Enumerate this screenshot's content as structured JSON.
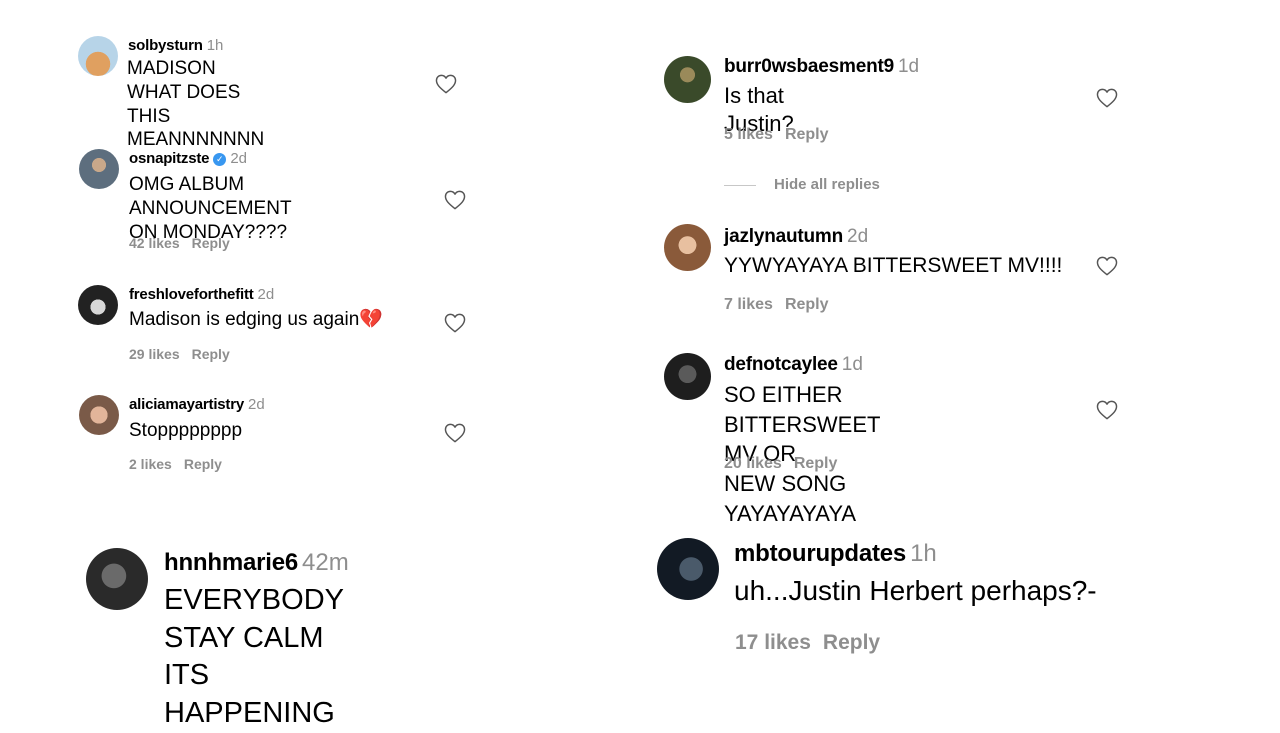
{
  "comments": [
    {
      "user": "solbysturn",
      "time": "1h",
      "text": "MADISON WHAT DOES THIS\nMEANNNNNNN",
      "likes": "",
      "reply": "",
      "avatar_color": "#d9b98a"
    },
    {
      "user": "osnapitzste",
      "time": "2d",
      "text": "OMG ALBUM ANNOUNCEMENT\nON MONDAY????",
      "likes": "42 likes",
      "reply": "Reply",
      "avatar_color": "#6b7a8a",
      "verified": true
    },
    {
      "user": "freshloveforthefitt",
      "time": "2d",
      "text": "Madison is edging us again",
      "emoji": "💔",
      "likes": "29 likes",
      "reply": "Reply",
      "avatar_color": "#2b2b2b"
    },
    {
      "user": "aliciamayartistry",
      "time": "2d",
      "text": "Stopppppppp",
      "likes": "2 likes",
      "reply": "Reply",
      "avatar_color": "#b88a6a"
    },
    {
      "user": "hnnhmarie6",
      "time": "42m",
      "text": "EVERYBODY STAY CALM ITS\nHAPPENING",
      "likes": "",
      "reply": "",
      "avatar_color": "#3a3a3a"
    },
    {
      "user": "burr0wsbaesment9",
      "time": "1d",
      "text": "Is that Justin?",
      "likes": "5 likes",
      "reply": "Reply",
      "avatar_color": "#4a5a3a"
    },
    {
      "user": "jazlynautumn",
      "time": "2d",
      "text": "YYWYAYAYA BITTERSWEET MV!!!!",
      "likes": "7 likes",
      "reply": "Reply",
      "avatar_color": "#a0704a"
    },
    {
      "user": "defnotcaylee",
      "time": "1d",
      "text": "SO EITHER BITTERSWEET MV OR\nNEW SONG YAYAYAYAYA",
      "likes": "20 likes",
      "reply": "Reply",
      "avatar_color": "#2a2a2a"
    },
    {
      "user": "mbtourupdates",
      "time": "1h",
      "text": "uh...Justin Herbert perhaps?-",
      "likes": "17 likes",
      "reply": "Reply",
      "avatar_color": "#1e2a3a"
    }
  ],
  "hide_replies": "Hide all replies",
  "colors": {
    "secondary_text": "#8e8e8e",
    "verified": "#3897f0"
  }
}
